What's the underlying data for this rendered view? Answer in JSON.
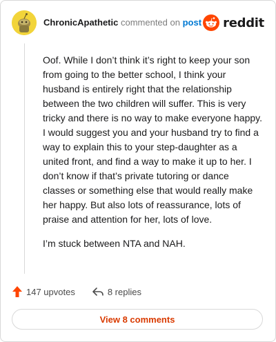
{
  "comment": {
    "author": "ChronicApathetic",
    "action_text": "commented on",
    "target_link": "post",
    "paragraphs": [
      "Oof. While I don’t think it’s right to keep your son from going to the better school, I think your husband is entirely right that the relationship between the two children will suffer. This is very tricky and there is no way to make everyone happy. I would suggest you and your husband try to find a way to explain this to your step-daughter as a united front, and find a way to make it up to her. I don’t know if that’s private tutoring or dance classes or something else that would really make her happy. But also lots of reassurance, lots of praise and attention for her, lots of love.",
      "I’m stuck between NTA and NAH."
    ]
  },
  "brand": {
    "name": "reddit",
    "accent": "#ff4500"
  },
  "actions": {
    "upvotes": "147 upvotes",
    "replies": "8 replies"
  },
  "view_button": {
    "label": "View 8 comments",
    "color": "#d93a00"
  },
  "icons": {
    "avatar": "snoo-avatar-icon",
    "brand": "reddit-logo-icon",
    "upvote": "upvote-arrow-icon",
    "reply": "reply-arrow-icon"
  }
}
